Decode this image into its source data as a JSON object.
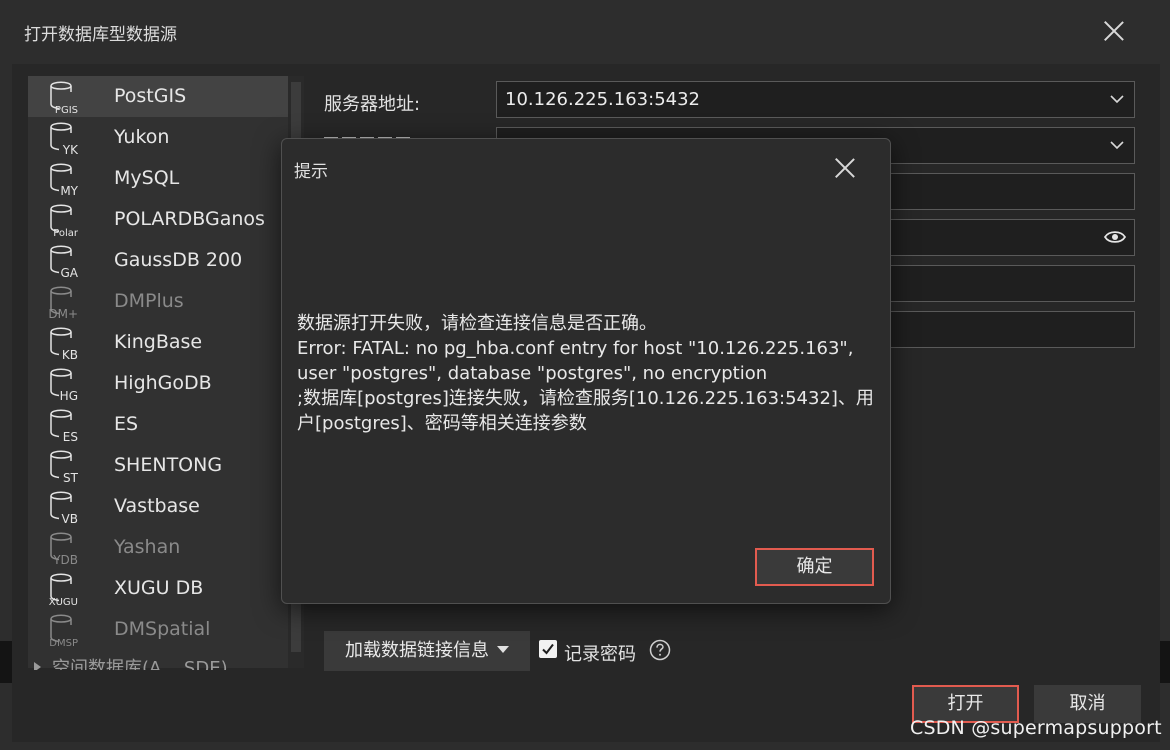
{
  "window": {
    "title": "打开数据库型数据源"
  },
  "sidebar": {
    "items": [
      {
        "label": "PostGIS",
        "icon_code": "PGIS",
        "selected": true,
        "enabled": true
      },
      {
        "label": "Yukon",
        "icon_code": "YK",
        "selected": false,
        "enabled": true
      },
      {
        "label": "MySQL",
        "icon_code": "MY",
        "selected": false,
        "enabled": true
      },
      {
        "label": "POLARDBGanos",
        "icon_code": "Polar",
        "selected": false,
        "enabled": true
      },
      {
        "label": "GaussDB 200",
        "icon_code": "GA",
        "selected": false,
        "enabled": true
      },
      {
        "label": "DMPlus",
        "icon_code": "DM+",
        "selected": false,
        "enabled": false
      },
      {
        "label": "KingBase",
        "icon_code": "KB",
        "selected": false,
        "enabled": true
      },
      {
        "label": "HighGoDB",
        "icon_code": "HG",
        "selected": false,
        "enabled": true
      },
      {
        "label": "ES",
        "icon_code": "ES",
        "selected": false,
        "enabled": true
      },
      {
        "label": "SHENTONG",
        "icon_code": "ST",
        "selected": false,
        "enabled": true
      },
      {
        "label": "Vastbase",
        "icon_code": "VB",
        "selected": false,
        "enabled": true
      },
      {
        "label": "Yashan",
        "icon_code": "YDB",
        "selected": false,
        "enabled": false
      },
      {
        "label": "XUGU DB",
        "icon_code": "XUGU",
        "selected": false,
        "enabled": true
      },
      {
        "label": "DMSpatial",
        "icon_code": "DMSP",
        "selected": false,
        "enabled": false
      }
    ],
    "partial_item": "空间数据库(A... SDE)"
  },
  "form": {
    "server_label": "服务器地址:",
    "server_value": "10.126.225.163:5432"
  },
  "footer": {
    "load_button": "加载数据链接信息",
    "remember_password": "记录密码",
    "remember_checked": true,
    "open_button": "打开",
    "cancel_button": "取消"
  },
  "dialog": {
    "title": "提示",
    "message_lines": [
      "数据源打开失败，请检查连接信息是否正确。",
      "Error: FATAL:  no pg_hba.conf entry for host \"10.126.225.163\",",
      "user \"postgres\", database \"postgres\", no encryption",
      ";数据库[postgres]连接失败，请检查服务[10.126.225.163:5432]、用",
      "户[postgres]、密码等相关连接参数"
    ],
    "ok_button": "确定"
  },
  "colors": {
    "accent_border": "#e25b4f",
    "background": "#2d2d2d"
  },
  "watermark": "CSDN @supermapsupport"
}
